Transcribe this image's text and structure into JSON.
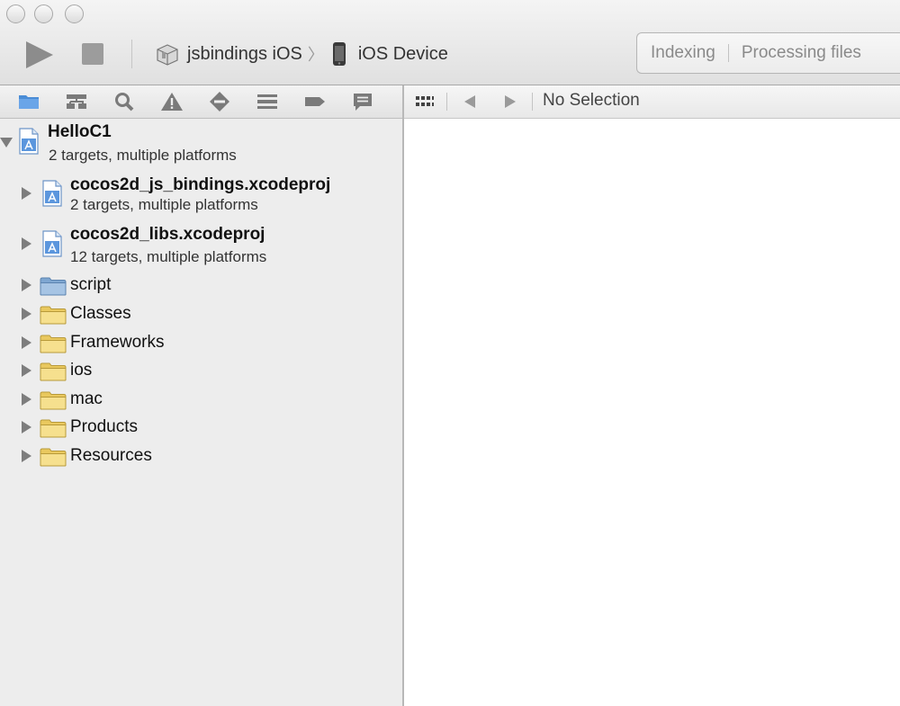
{
  "toolbar": {
    "scheme_name": "jsbindings iOS",
    "separator": "〉",
    "destination": "iOS Device",
    "activity_status": "Indexing",
    "activity_detail": "Processing files",
    "run_icon": "play-icon",
    "stop_icon": "stop-icon"
  },
  "navigator_tabs": [
    "project-navigator-icon",
    "symbol-navigator-icon",
    "search-navigator-icon",
    "issue-navigator-icon",
    "test-navigator-icon",
    "debug-navigator-icon",
    "breakpoint-navigator-icon",
    "log-navigator-icon"
  ],
  "tree": {
    "root": {
      "title": "HelloC1",
      "subtitle": "2 targets, multiple platforms"
    },
    "subprojects": [
      {
        "title": "cocos2d_js_bindings.xcodeproj",
        "subtitle": "2 targets, multiple platforms"
      },
      {
        "title": "cocos2d_libs.xcodeproj",
        "subtitle": "12 targets, multiple platforms"
      }
    ],
    "folders": [
      {
        "label": "script",
        "color": "blue"
      },
      {
        "label": "Classes",
        "color": "yellow"
      },
      {
        "label": "Frameworks",
        "color": "yellow"
      },
      {
        "label": "ios",
        "color": "yellow"
      },
      {
        "label": "mac",
        "color": "yellow"
      },
      {
        "label": "Products",
        "color": "yellow"
      },
      {
        "label": "Resources",
        "color": "yellow"
      }
    ]
  },
  "jumpbar": {
    "selection": "No Selection"
  },
  "colors": {
    "folder_yellow": "#f1d97a",
    "folder_blue": "#8fb3d9",
    "navigator_bg": "#ededed",
    "editor_bg": "#ffffff",
    "nav_icon_blue": "#4a8cd6"
  }
}
